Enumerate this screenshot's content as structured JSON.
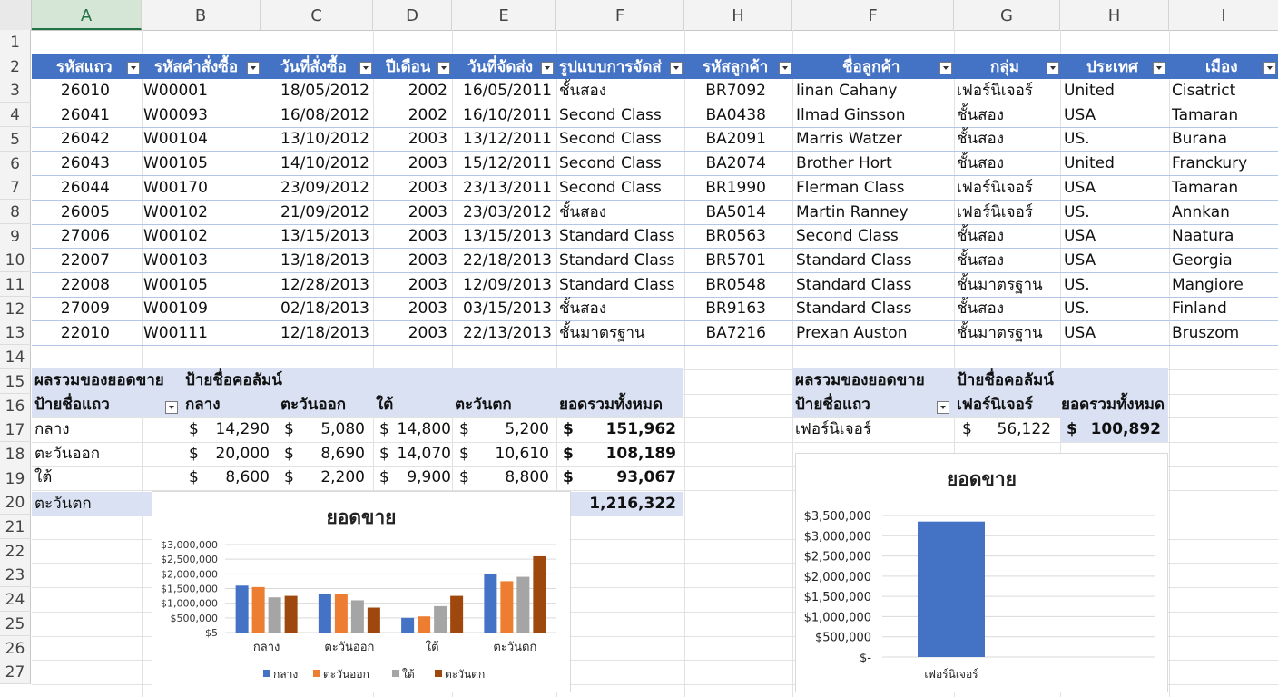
{
  "column_headers": [
    "A",
    "B",
    "C",
    "D",
    "E",
    "F",
    "H",
    "F",
    "G",
    "H",
    "I"
  ],
  "row_numbers": [
    "1",
    "2",
    "3",
    "4",
    "5",
    "6",
    "7",
    "8",
    "9",
    "10",
    "11",
    "12",
    "13",
    "14",
    "15",
    "16",
    "17",
    "18",
    "19",
    "20",
    "21",
    "22",
    "23",
    "24",
    "25",
    "26",
    "27"
  ],
  "table": {
    "headers": [
      "รหัสแถว",
      "รหัสคำสั่งซื้อ",
      "วันที่สั่งซื้อ",
      "ปีเดือน",
      "วันที่จัดส่ง",
      "รูปแบบการจัดส่",
      "รหัสลูกค้า",
      "ชื่อลูกค้า",
      "กลุ่ม",
      "ประเทศ",
      "เมือง"
    ],
    "rows": [
      [
        "26010",
        "W00001",
        "18/05/2012",
        "2002",
        "16/05/2011",
        "ชั้นสอง",
        "BR7092",
        "Iinan Cahany",
        "เฟอร์นิเจอร์",
        "United",
        "Cisatrict"
      ],
      [
        "26041",
        "W00093",
        "16/08/2012",
        "2002",
        "16/10/2011",
        "Second Class",
        "BA0438",
        "Ilmad Ginsson",
        "ชั้นสอง",
        "USA",
        "Tamaran"
      ],
      [
        "26042",
        "W00104",
        "13/10/2012",
        "2003",
        "13/12/2011",
        "Second Class",
        "BA2091",
        "Marris Watzer",
        "ชั้นสอง",
        "US.",
        "Burana"
      ],
      [
        "26043",
        "W00105",
        "14/10/2012",
        "2003",
        "15/12/2011",
        "Second Class",
        "BA2074",
        "Brother Hort",
        "ชั้นสอง",
        "United",
        "Franckury"
      ],
      [
        "26044",
        "W00170",
        "23/09/2012",
        "2003",
        "23/13/2011",
        "Second Class",
        "BR1990",
        "Flerman Class",
        "เฟอร์นิเจอร์",
        "USA",
        "Tamaran"
      ],
      [
        "26005",
        "W00102",
        "21/09/2012",
        "2003",
        "23/03/2012",
        "ชั้นสอง",
        "BA5014",
        "Martin Ranney",
        "เฟอร์นิเจอร์",
        "US.",
        "Annkan"
      ],
      [
        "27006",
        "W00102",
        "13/15/2013",
        "2003",
        "13/15/2013",
        "Standard Class",
        "BR0563",
        "Second Class",
        "ชั้นสอง",
        "USA",
        "Naatura"
      ],
      [
        "22007",
        "W00103",
        "13/18/2013",
        "2003",
        "22/18/2013",
        "Standard Class",
        "BR5701",
        "Standard Class",
        "ชั้นสอง",
        "USA",
        "Georgia"
      ],
      [
        "22008",
        "W00105",
        "12/28/2013",
        "2003",
        "12/09/2013",
        "Standard Class",
        "BR0548",
        "Standard Class",
        "ชั้นมาตรฐาน",
        "US.",
        "Mangiore"
      ],
      [
        "27009",
        "W00109",
        "02/18/2013",
        "2003",
        "03/15/2013",
        "ชั้นสอง",
        "BR9163",
        "Standard Class",
        "ชั้นสอง",
        "US.",
        "Finland"
      ],
      [
        "22010",
        "W00111",
        "12/18/2013",
        "2003",
        "22/13/2013",
        "ชั้นมาตรฐาน",
        "BA7216",
        "Prexan Auston",
        "ชั้นมาตรฐาน",
        "USA",
        "Bruszom"
      ]
    ]
  },
  "pivot1": {
    "label_values": "ผลรวมของยอดขาย",
    "label_columns": "ป้ายชื่อคอลัมน์",
    "label_rows": "ป้ายชื่อแถว",
    "col_headers": [
      "กลาง",
      "ตะวันออก",
      "ใต้",
      "ตะวันตก",
      "ยอดรวมทั้งหมด"
    ],
    "rows": [
      {
        "label": "กลาง",
        "cells": [
          "14,290",
          "5,080",
          "14,800",
          "5,200"
        ],
        "total": "151,962"
      },
      {
        "label": "ตะวันออก",
        "cells": [
          "20,000",
          "8,690",
          "14,070",
          "10,610"
        ],
        "total": "108,189"
      },
      {
        "label": "ใต้",
        "cells": [
          "8,600",
          "2,200",
          "9,900",
          "8,800"
        ],
        "total": "93,067"
      }
    ],
    "last_row_label": "ตะวันตก",
    "last_row_total": "1,216,322",
    "currency": "$"
  },
  "pivot2": {
    "label_values": "ผลรวมของยอดขาย",
    "label_columns": "ป้ายชื่อคอลัมน์",
    "label_rows": "ป้ายชื่อแถว",
    "col_header": "เฟอร์นิเจอร์",
    "total_header": "ยอดรวมทั้งหมด",
    "row_label": "เฟอร์นิเจอร์",
    "value": "56,122",
    "total": "100,892",
    "currency": "$"
  },
  "colors": {
    "table_header": "#4472c4",
    "pivot_header": "#d9e1f2",
    "s1": "#4472c4",
    "s2": "#ed7d31",
    "s3": "#a5a5a5",
    "s4": "#9e480e"
  },
  "chart_data": [
    {
      "type": "bar",
      "title": "ยอดขาย",
      "categories": [
        "กลาง",
        "ตะวันออก",
        "ใต้",
        "ตะวันตก"
      ],
      "series": [
        {
          "name": "กลาง",
          "values": [
            1600000,
            1300000,
            500000,
            2000000
          ]
        },
        {
          "name": "ตะวันออก",
          "values": [
            1550000,
            1300000,
            550000,
            1750000
          ]
        },
        {
          "name": "ใต้",
          "values": [
            1200000,
            1100000,
            900000,
            1900000
          ]
        },
        {
          "name": "ตะวันตก",
          "values": [
            1250000,
            850000,
            1250000,
            2600000
          ]
        }
      ],
      "ytick_labels": [
        "$5",
        "$500,000",
        "$1,000,000",
        "$1,500,000",
        "$2,000,000",
        "$2,500,000",
        "$3,000,000"
      ],
      "ylim": [
        0,
        3000000
      ],
      "legend": "bottom",
      "grid": true
    },
    {
      "type": "bar",
      "title": "ยอดขาย",
      "categories": [
        "เฟอร์นิเจอร์"
      ],
      "series": [
        {
          "values": [
            3350000
          ]
        }
      ],
      "ytick_labels": [
        "$-",
        "$500,000",
        "$1,000,000",
        "$1,500,000",
        "$2,000,000",
        "$2,500,000",
        "$3,000,000",
        "$3,500,000"
      ],
      "ylim": [
        0,
        3500000
      ],
      "grid": true
    }
  ]
}
